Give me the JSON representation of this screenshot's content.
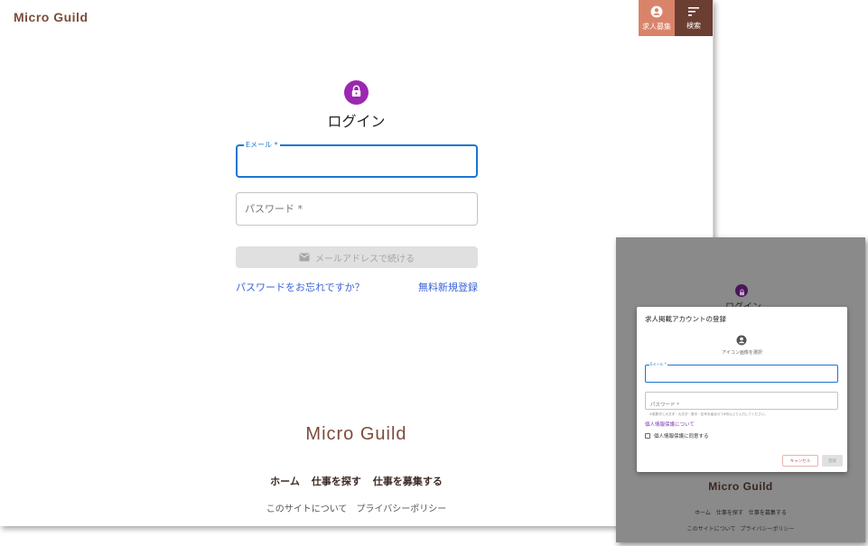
{
  "header": {
    "brand": "Micro Guild",
    "nav": {
      "post_job_label": "求人募集",
      "search_label": "検索"
    }
  },
  "login": {
    "title": "ログイン",
    "email_label": "Eメール *",
    "email_value": "",
    "password_placeholder": "パスワード *",
    "submit_label": "メールアドレスで続ける",
    "forgot_link": "パスワードをお忘れですか？",
    "register_link": "無料新規登録"
  },
  "footer": {
    "brand": "Micro Guild",
    "nav": [
      "ホーム",
      "仕事を探す",
      "仕事を募集する"
    ],
    "sub": [
      "このサイトについて",
      "プライバシーポリシー"
    ]
  },
  "inset": {
    "background_title": "ログイン",
    "background_brand": "Micro Guild",
    "background_nav": [
      "ホーム",
      "仕事を探す",
      "仕事を募集する"
    ],
    "background_sub": [
      "このサイトについて",
      "プライバシーポリシー"
    ],
    "dialog": {
      "title": "求人掲載アカウントの登録",
      "icon_caption": "アイコン画像を選択",
      "email_label": "Eメール *",
      "email_value": "",
      "password_placeholder": "パスワード *",
      "password_hint": "※英数字と大文字・大文字・数字・記号を組合せて8桁以上で入力してください。",
      "privacy_link": "個人情報保護について",
      "consent_label": "個人情報保護に同意する",
      "consent_checked": false,
      "cancel_label": "キャンセル",
      "register_label": "登録"
    }
  },
  "colors": {
    "brand": "#7b4c3c",
    "nav_post_bg": "#d9846a",
    "nav_search_bg": "#6b3e32",
    "avatar_bg": "#9c27b0",
    "focus_blue": "#1976d2",
    "link_blue": "#3b63d8",
    "overlay_gray": "#8a8a8a"
  },
  "icons": {
    "post_job": "account-circle-icon",
    "search": "sort-lines-icon",
    "login_avatar": "lock-icon",
    "submit": "mail-icon",
    "dialog_avatar": "account-circle-icon"
  }
}
